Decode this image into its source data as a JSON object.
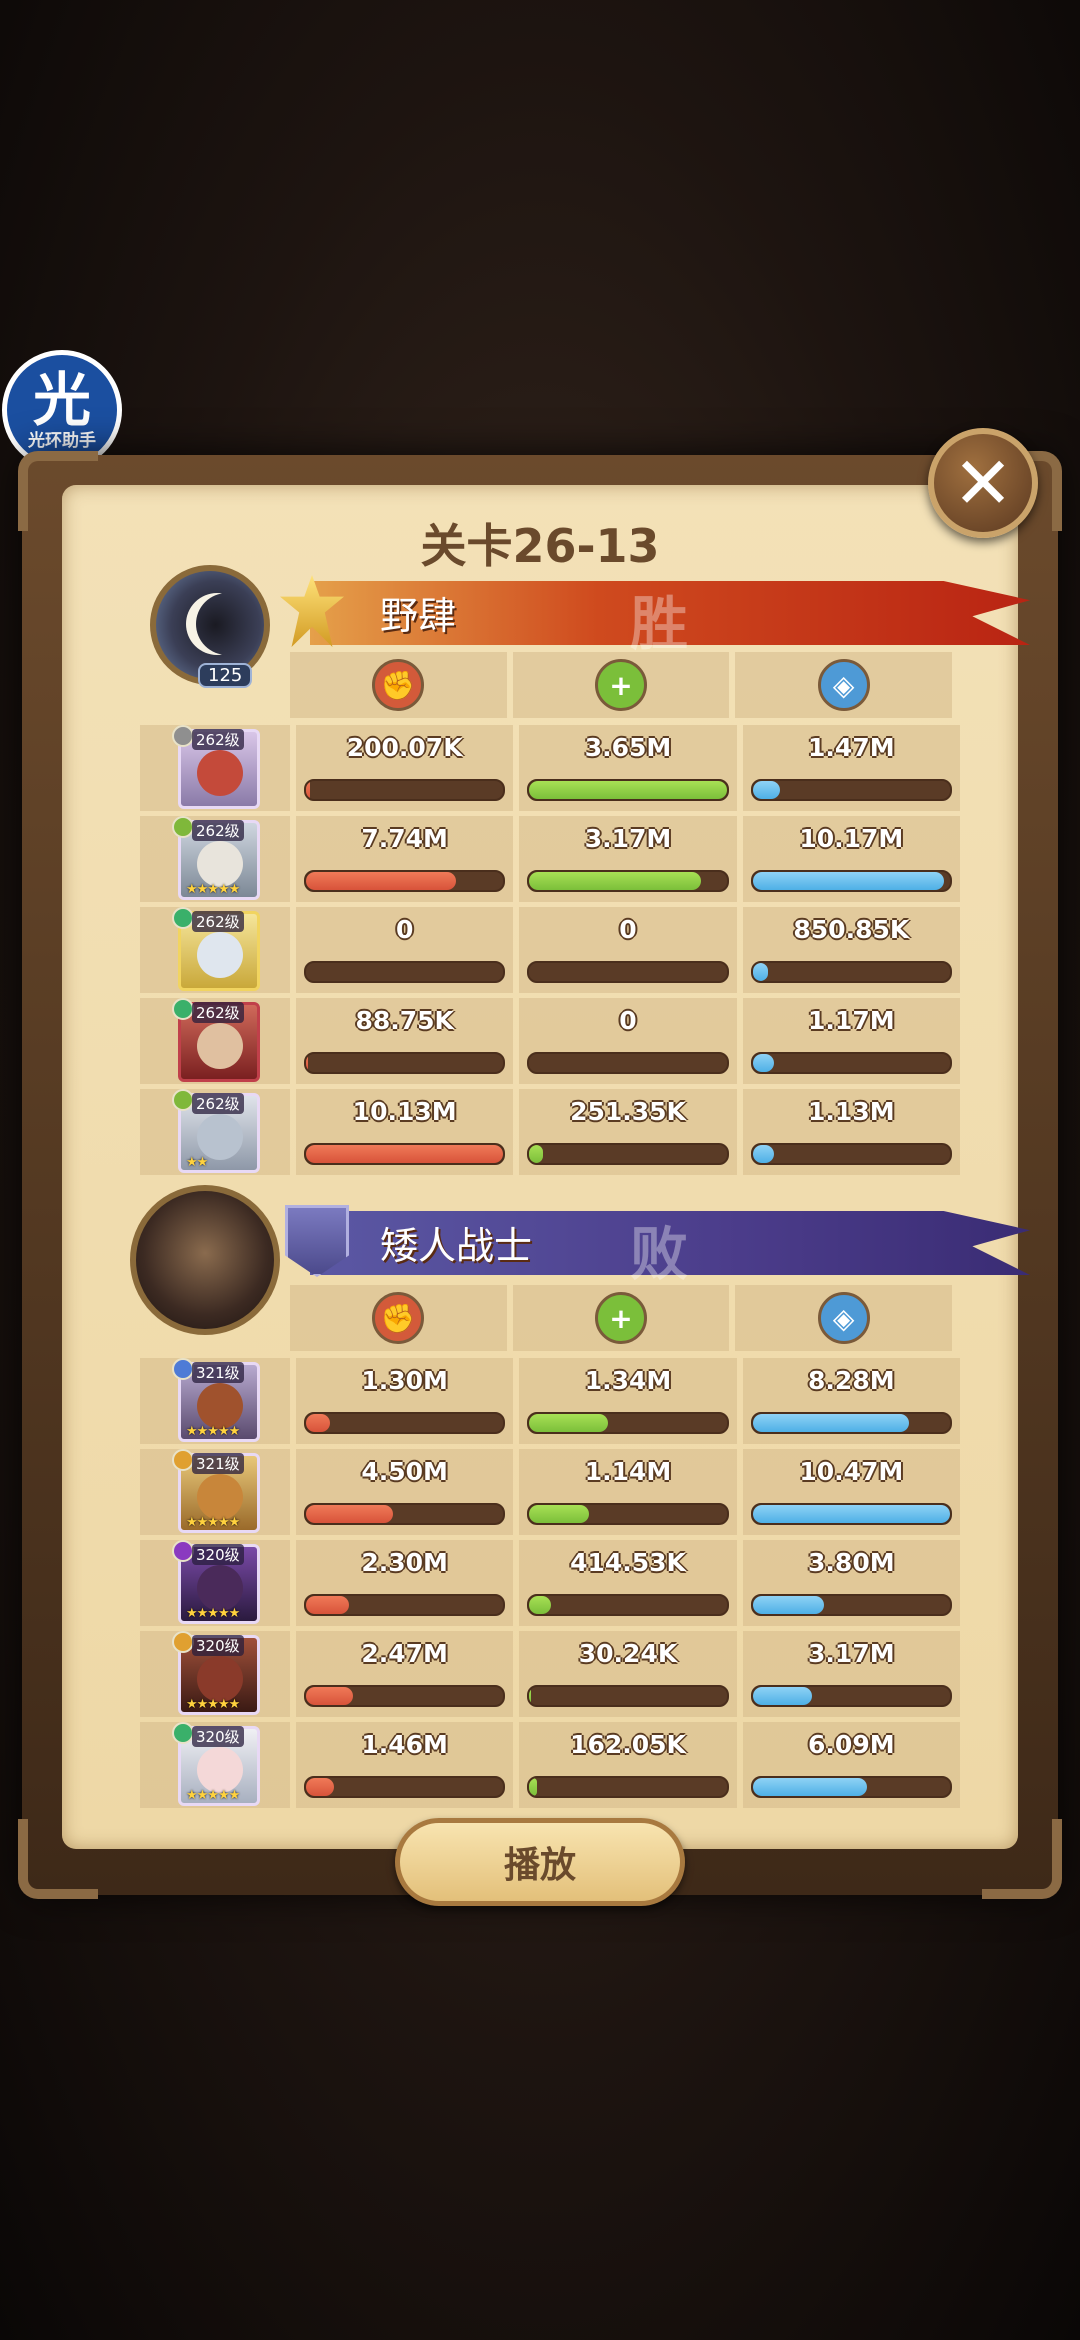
{
  "watermark": {
    "big": "光",
    "small": "光环助手"
  },
  "title": "关卡26-13",
  "close_label": "✕",
  "play_label": "播放",
  "teams": [
    {
      "name": "野肆",
      "result": "胜",
      "avatar_level": "125",
      "heroes": [
        {
          "level": "262级",
          "stars": "",
          "dmg": "200.07K",
          "heal": "3.65M",
          "def": "1.47M",
          "dmg_pct": 2,
          "heal_pct": 100,
          "def_pct": 14
        },
        {
          "level": "262级",
          "stars": "★★★★★",
          "dmg": "7.74M",
          "heal": "3.17M",
          "def": "10.17M",
          "dmg_pct": 76,
          "heal_pct": 87,
          "def_pct": 97
        },
        {
          "level": "262级",
          "stars": "",
          "dmg": "0",
          "heal": "0",
          "def": "850.85K",
          "dmg_pct": 0,
          "heal_pct": 0,
          "def_pct": 8
        },
        {
          "level": "262级",
          "stars": "",
          "dmg": "88.75K",
          "heal": "0",
          "def": "1.17M",
          "dmg_pct": 1,
          "heal_pct": 0,
          "def_pct": 11
        },
        {
          "level": "262级",
          "stars": "★★",
          "dmg": "10.13M",
          "heal": "251.35K",
          "def": "1.13M",
          "dmg_pct": 100,
          "heal_pct": 7,
          "def_pct": 11
        }
      ]
    },
    {
      "name": "矮人战士",
      "result": "败",
      "heroes": [
        {
          "level": "321级",
          "stars": "★★★★★",
          "dmg": "1.30M",
          "heal": "1.34M",
          "def": "8.28M",
          "dmg_pct": 12,
          "heal_pct": 40,
          "def_pct": 79
        },
        {
          "level": "321级",
          "stars": "★★★★★",
          "dmg": "4.50M",
          "heal": "1.14M",
          "def": "10.47M",
          "dmg_pct": 44,
          "heal_pct": 30,
          "def_pct": 100
        },
        {
          "level": "320级",
          "stars": "★★★★★",
          "dmg": "2.30M",
          "heal": "414.53K",
          "def": "3.80M",
          "dmg_pct": 22,
          "heal_pct": 11,
          "def_pct": 36
        },
        {
          "level": "320级",
          "stars": "★★★★★",
          "dmg": "2.47M",
          "heal": "30.24K",
          "def": "3.17M",
          "dmg_pct": 24,
          "heal_pct": 1,
          "def_pct": 30
        },
        {
          "level": "320级",
          "stars": "★★★★★",
          "dmg": "1.46M",
          "heal": "162.05K",
          "def": "6.09M",
          "dmg_pct": 14,
          "heal_pct": 4,
          "def_pct": 58
        }
      ]
    }
  ],
  "colors": {
    "damage": "#d8533a",
    "heal": "#7bbf3a",
    "defense": "#4eb0e6",
    "win_banner": "#c93a1a",
    "lose_banner": "#4b3c8a"
  }
}
